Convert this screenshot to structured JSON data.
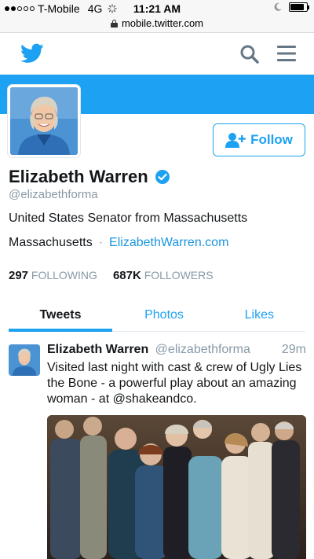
{
  "status": {
    "carrier": "T-Mobile",
    "network": "4G",
    "time": "11:21 AM",
    "battery_level": 0.85
  },
  "browser": {
    "url": "mobile.twitter.com"
  },
  "nav": {
    "logo_icon": "twitter-bird-icon",
    "search_icon": "search-icon",
    "menu_icon": "hamburger-menu-icon"
  },
  "colors": {
    "brand": "#1da1f2",
    "link": "#1b95e0",
    "muted": "#8899a6",
    "text": "#14171a"
  },
  "profile": {
    "name": "Elizabeth Warren",
    "verified": true,
    "handle": "@elizabethforma",
    "bio": "United States Senator from Massachusetts",
    "location": "Massachusetts",
    "separator": "·",
    "website": "ElizabethWarren.com",
    "following_count": "297",
    "following_label": "FOLLOWING",
    "followers_count": "687K",
    "followers_label": "FOLLOWERS",
    "follow_label": "Follow"
  },
  "tabs": [
    {
      "label": "Tweets",
      "active": true
    },
    {
      "label": "Photos",
      "active": false
    },
    {
      "label": "Likes",
      "active": false
    }
  ],
  "tweet": {
    "author": "Elizabeth Warren",
    "handle": "@elizabethforma",
    "time": "29m",
    "text": "Visited last night with cast & crew of Ugly Lies the Bone - a powerful play about an amazing woman - at @shakeandco."
  }
}
